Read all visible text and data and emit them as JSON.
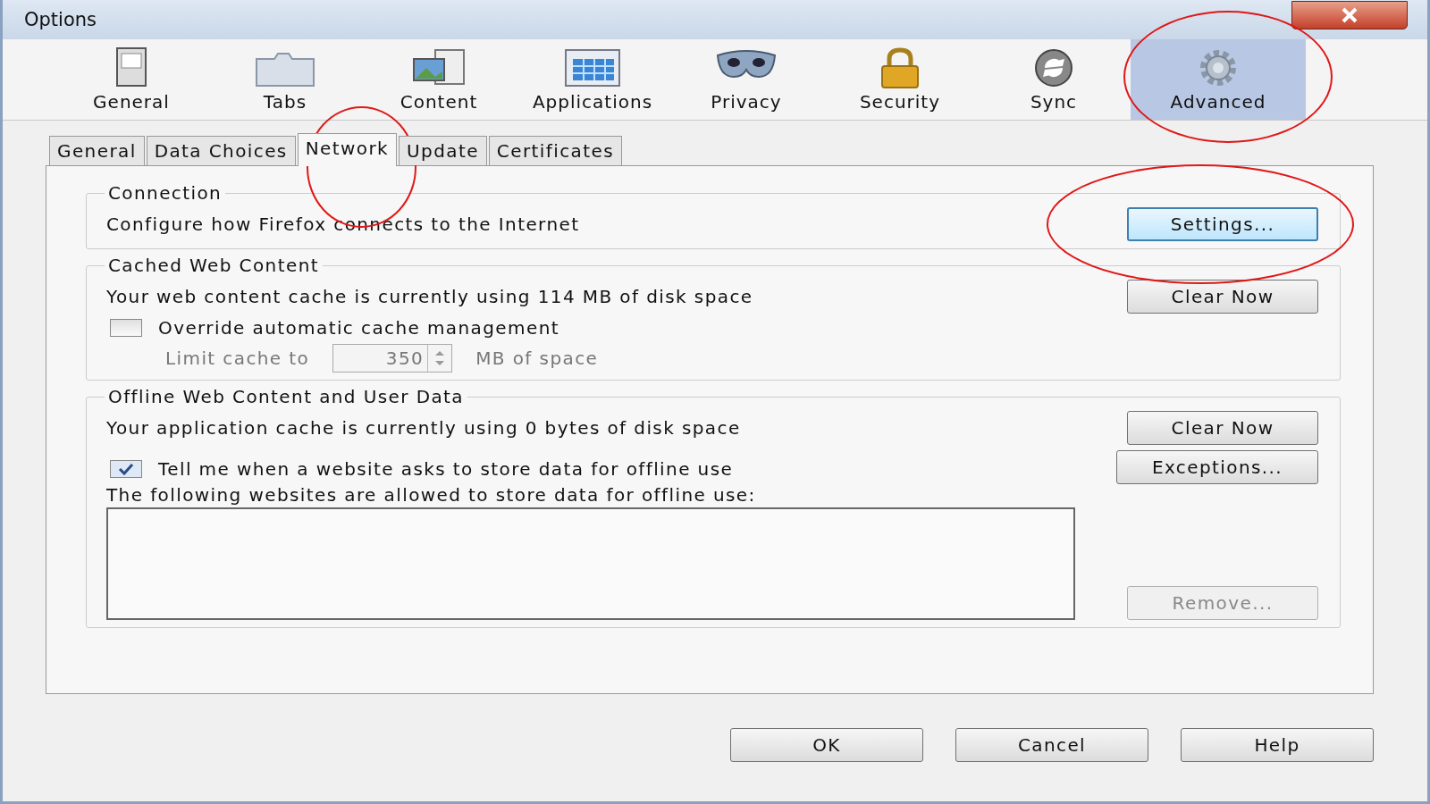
{
  "window": {
    "title": "Options"
  },
  "panes": [
    {
      "label": "General",
      "selected": false,
      "circled": false
    },
    {
      "label": "Tabs",
      "selected": false,
      "circled": false
    },
    {
      "label": "Content",
      "selected": false,
      "circled": false
    },
    {
      "label": "Applications",
      "selected": false,
      "circled": false
    },
    {
      "label": "Privacy",
      "selected": false,
      "circled": false
    },
    {
      "label": "Security",
      "selected": false,
      "circled": false
    },
    {
      "label": "Sync",
      "selected": false,
      "circled": false
    },
    {
      "label": "Advanced",
      "selected": true,
      "circled": true
    }
  ],
  "tabs": [
    {
      "label": "General",
      "selected": false,
      "circled": false
    },
    {
      "label": "Data Choices",
      "selected": false,
      "circled": false
    },
    {
      "label": "Network",
      "selected": true,
      "circled": true
    },
    {
      "label": "Update",
      "selected": false,
      "circled": false
    },
    {
      "label": "Certificates",
      "selected": false,
      "circled": false
    }
  ],
  "connection": {
    "legend": "Connection",
    "text": "Configure how Firefox connects to the Internet",
    "button": {
      "label": "Settings...",
      "circled": true,
      "disabled": false
    }
  },
  "cache": {
    "legend": "Cached Web Content",
    "text": "Your web content cache is currently using 114 MB of disk space",
    "button": {
      "label": "Clear Now",
      "disabled": false
    },
    "override": {
      "label": "Override automatic cache management",
      "checked": false
    },
    "limit": {
      "label": "Limit cache to",
      "value": "350",
      "unit": "MB of space",
      "disabled": true
    }
  },
  "offline": {
    "legend": "Offline Web Content and User Data",
    "text": "Your application cache is currently using 0 bytes of disk space",
    "button": {
      "label": "Clear Now",
      "disabled": false
    },
    "tell": {
      "label": "Tell me when a website asks to store data for offline use",
      "checked": true
    },
    "exceptions": {
      "label": "Exceptions...",
      "disabled": false
    },
    "list_label": "The following websites are allowed to store data for offline use:",
    "remove": {
      "label": "Remove...",
      "disabled": true
    }
  },
  "buttons": [
    "OK",
    "Cancel",
    "Help"
  ]
}
